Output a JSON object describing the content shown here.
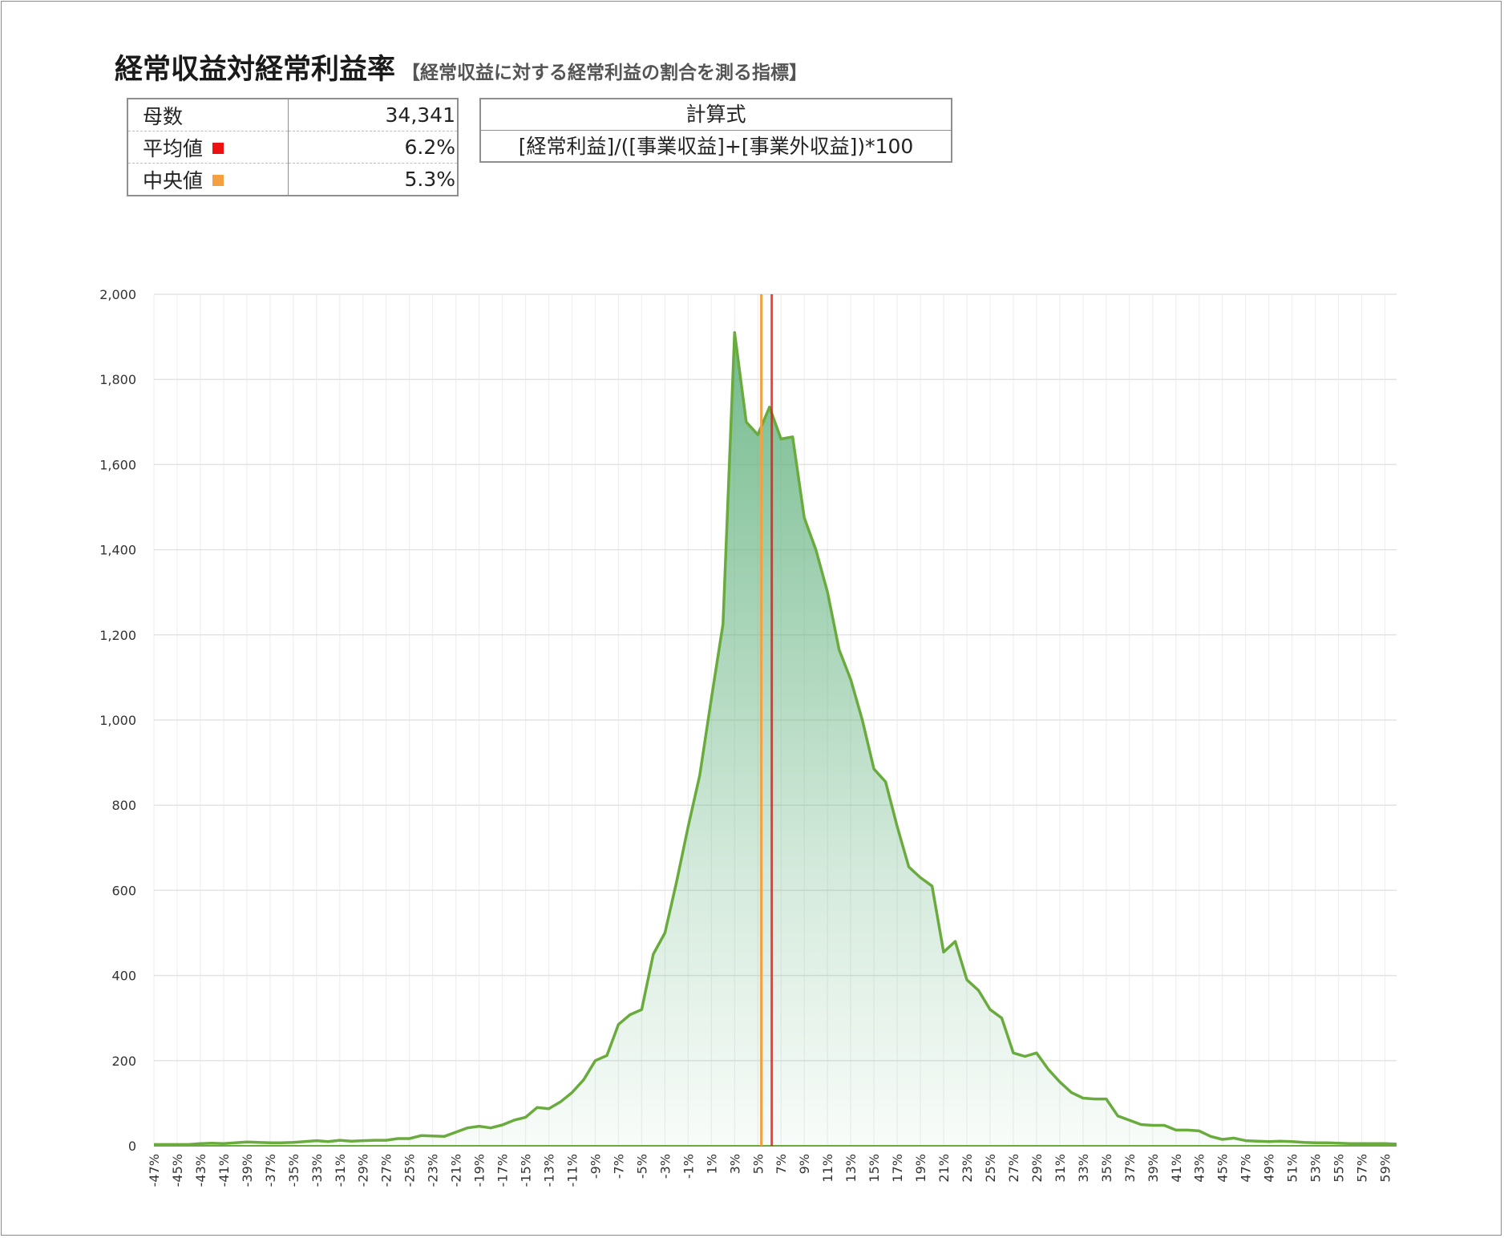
{
  "title": {
    "main": "経常収益対経常利益率",
    "sub": "【経常収益に対する経常利益の割合を測る指標】"
  },
  "stats": {
    "count_label": "母数",
    "count_value": "34,341",
    "mean_label": "平均値",
    "mean_value": "6.2%",
    "median_label": "中央値",
    "median_value": "5.3%",
    "mean_color": "#ee1111",
    "median_color": "#f4a040"
  },
  "formula": {
    "label": "計算式",
    "expression": "[経常利益]/([事業収益]+[事業外収益])*100"
  },
  "chart_data": {
    "type": "area",
    "x_start": -47,
    "x_step": 1,
    "x_end": 60,
    "x_tick_labels": [
      "-47%",
      "-45%",
      "-43%",
      "-41%",
      "-39%",
      "-37%",
      "-35%",
      "-33%",
      "-31%",
      "-29%",
      "-27%",
      "-25%",
      "-23%",
      "-21%",
      "-19%",
      "-17%",
      "-15%",
      "-13%",
      "-11%",
      "-9%",
      "-7%",
      "-5%",
      "-3%",
      "-1%",
      "1%",
      "3%",
      "5%",
      "7%",
      "9%",
      "11%",
      "13%",
      "15%",
      "17%",
      "19%",
      "21%",
      "23%",
      "25%",
      "27%",
      "29%",
      "31%",
      "33%",
      "35%",
      "37%",
      "39%",
      "41%",
      "43%",
      "45%",
      "47%",
      "49%",
      "51%",
      "53%",
      "55%",
      "57%",
      "59%"
    ],
    "y_tick_labels": [
      "0",
      "200",
      "400",
      "600",
      "800",
      "1,000",
      "1,200",
      "1,400",
      "1,600",
      "1,800",
      "2,000"
    ],
    "ylim": [
      0,
      2000
    ],
    "values": [
      3,
      3,
      3,
      3,
      5,
      6,
      5,
      7,
      9,
      8,
      7,
      7,
      8,
      10,
      12,
      10,
      13,
      11,
      12,
      13,
      13,
      17,
      17,
      24,
      23,
      22,
      32,
      42,
      46,
      42,
      49,
      60,
      67,
      90,
      87,
      103,
      125,
      155,
      200,
      212,
      285,
      308,
      320,
      450,
      500,
      620,
      750,
      870,
      1050,
      1225,
      1910,
      1700,
      1670,
      1735,
      1660,
      1665,
      1475,
      1400,
      1300,
      1165,
      1095,
      1000,
      885,
      855,
      750,
      655,
      630,
      610,
      455,
      480,
      390,
      365,
      320,
      300,
      218,
      210,
      218,
      180,
      150,
      125,
      112,
      110,
      110,
      70,
      60,
      50,
      48,
      48,
      37,
      37,
      35,
      22,
      15,
      18,
      12,
      11,
      10,
      11,
      10,
      8,
      7,
      7,
      6,
      5,
      5,
      5,
      5,
      4
    ],
    "median_x": 5.3,
    "mean_x": 6.2,
    "line_color": "#6aab3e",
    "fill_color_top": "#5fb07c"
  }
}
